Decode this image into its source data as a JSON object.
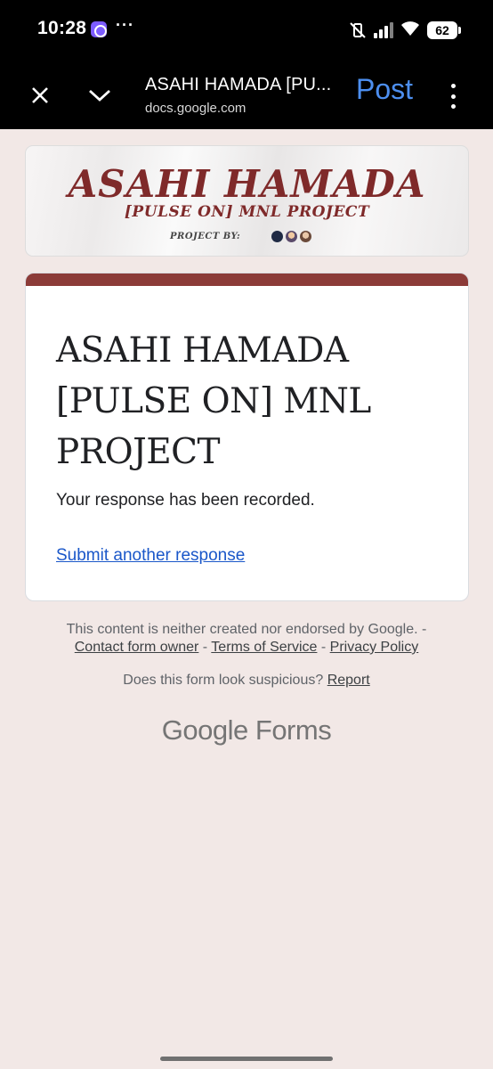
{
  "status_bar": {
    "time": "10:28",
    "dots": "···",
    "battery": "62"
  },
  "browser": {
    "page_title": "ASAHI HAMADA [PU...",
    "url": "docs.google.com",
    "post_label": "Post"
  },
  "banner": {
    "title": "ASAHI HAMADA",
    "subtitle": "[PULSE ON] MNL PROJECT",
    "project_by": "PROJECT BY:"
  },
  "form": {
    "title": "ASAHI HAMADA [PULSE ON] MNL PROJECT",
    "message": "Your response has been recorded.",
    "submit_another": "Submit another response"
  },
  "footer": {
    "disclaimer": "This content is neither created nor endorsed by Google. -",
    "contact": "Contact form owner",
    "sep1": " - ",
    "terms": "Terms of Service",
    "sep2": " - ",
    "privacy": "Privacy Policy",
    "suspicious": "Does this form look suspicious? ",
    "report": "Report",
    "brand_google": "Google",
    "brand_forms": " Forms"
  },
  "colors": {
    "accent": "#8c3b38",
    "link": "#1a57c9",
    "page_bg": "#f2e8e6",
    "post": "#4d8ff0"
  }
}
